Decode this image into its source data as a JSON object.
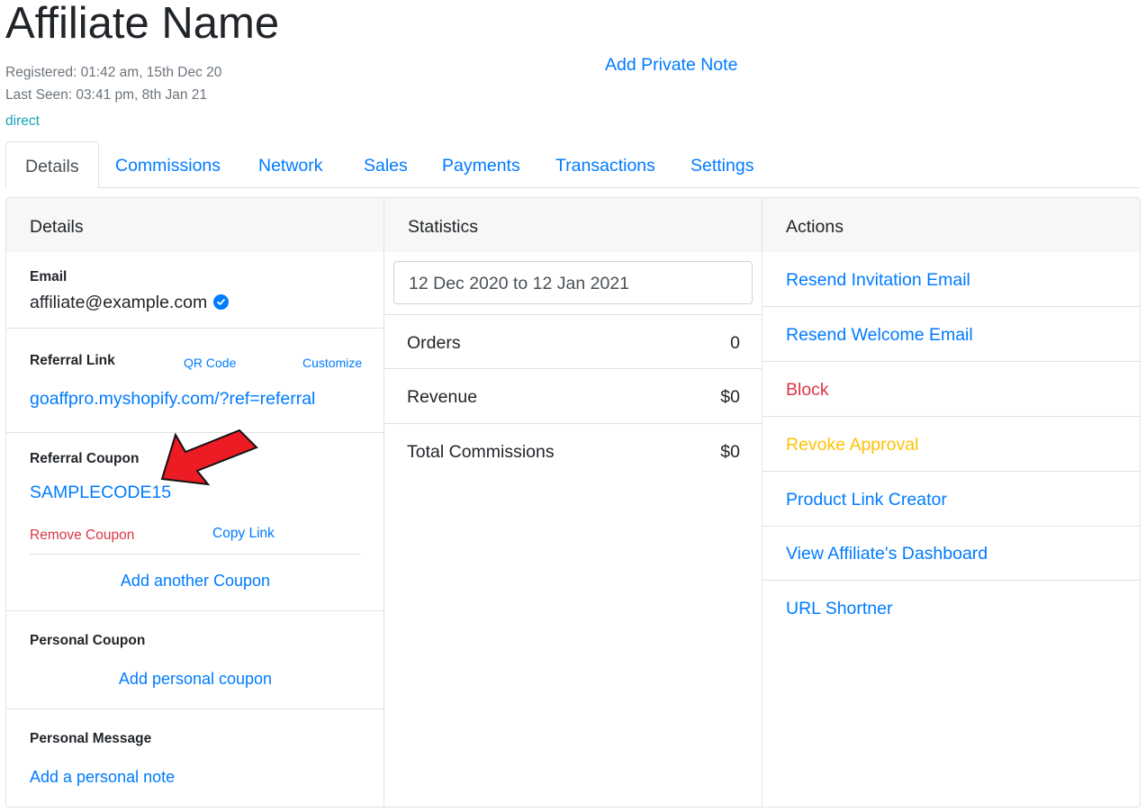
{
  "header": {
    "title": "Affiliate Name",
    "registered": "Registered: 01:42 am, 15th Dec 20",
    "last_seen": "Last Seen: 03:41 pm, 8th Jan 21",
    "source": "direct",
    "private_note_link": "Add Private Note"
  },
  "tabs": [
    {
      "label": "Details",
      "active": true
    },
    {
      "label": "Commissions"
    },
    {
      "label": "Network"
    },
    {
      "label": "Sales"
    },
    {
      "label": "Payments"
    },
    {
      "label": "Transactions"
    },
    {
      "label": "Settings"
    }
  ],
  "details": {
    "heading": "Details",
    "email_label": "Email",
    "email_value": "affiliate@example.com",
    "email_verified_icon": "check-circle-icon",
    "referral_link_label": "Referral Link",
    "qr_code_link": "QR Code",
    "customize_link": "Customize",
    "referral_link_value": "goaffpro.myshopify.com/?ref=referral",
    "referral_coupon_label": "Referral Coupon",
    "coupon_code": "SAMPLECODE15",
    "remove_coupon": "Remove Coupon",
    "copy_link": "Copy Link",
    "add_another_coupon": "Add another Coupon",
    "personal_coupon_label": "Personal Coupon",
    "add_personal_coupon": "Add personal coupon",
    "personal_message_label": "Personal Message",
    "add_personal_note": "Add a personal note"
  },
  "statistics": {
    "heading": "Statistics",
    "date_range": "12 Dec 2020 to 12 Jan 2021",
    "rows": [
      {
        "label": "Orders",
        "value": "0"
      },
      {
        "label": "Revenue",
        "value": "$0"
      },
      {
        "label": "Total Commissions",
        "value": "$0"
      }
    ]
  },
  "actions": {
    "heading": "Actions",
    "items": [
      {
        "label": "Resend Invitation Email",
        "style": "primary"
      },
      {
        "label": "Resend Welcome Email",
        "style": "primary"
      },
      {
        "label": "Block",
        "style": "danger"
      },
      {
        "label": "Revoke Approval",
        "style": "warning"
      },
      {
        "label": "Product Link Creator",
        "style": "primary"
      },
      {
        "label": "View Affiliate's Dashboard",
        "style": "primary"
      },
      {
        "label": "URL Shortner",
        "style": "primary"
      }
    ]
  },
  "colors": {
    "primary": "#007bff",
    "danger": "#dc3545",
    "warning": "#ffc107",
    "info": "#17a2b8",
    "annotation_arrow": "#ed1c24"
  }
}
